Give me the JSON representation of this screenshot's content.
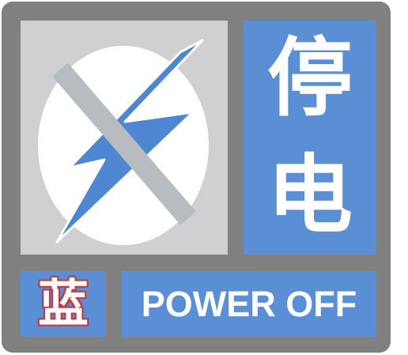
{
  "signal": {
    "title_chars": [
      "停",
      "电"
    ],
    "level_char": "蓝",
    "label": "POWER OFF",
    "icon": "power-off-lightning-crossed-icon"
  },
  "colors": {
    "frame": "#808080",
    "panel": "#5a8fd6",
    "icon_background": "#d0cfd1",
    "lightning": "#4f86d2",
    "cross": "#b7bcc0",
    "level_outline": "#c23a3a"
  }
}
